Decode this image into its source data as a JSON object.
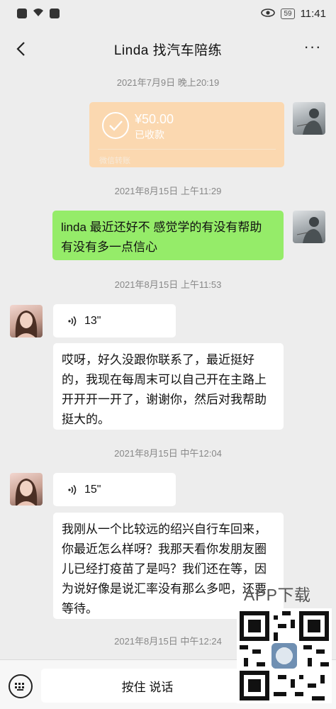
{
  "status_bar": {
    "time": "11:41",
    "battery": "59",
    "icons": [
      "alert-icon",
      "wifi-icon",
      "upload-icon",
      "eye-icon",
      "battery-icon"
    ]
  },
  "nav": {
    "title": "Linda 找汽车陪练",
    "back_icon": "chevron-left-icon",
    "more_icon": "more-dots-icon",
    "more_label": "···"
  },
  "messages": {
    "ts1": "2021年7月9日 晚上20:19",
    "transfer": {
      "amount": "¥50.00",
      "status": "已收款",
      "footer": "微信转账"
    },
    "ts2": "2021年8月15日 上午11:29",
    "msg1": "linda 最近还好不 感觉学的有没有帮助 有没有多一点信心",
    "ts3": "2021年8月15日 上午11:53",
    "voice1": "13\"",
    "msg2": "哎呀，好久没跟你联系了，最近挺好的，我现在每周末可以自己开在主路上开开开一开了，谢谢你，然后对我帮助挺大的。",
    "ts4": "2021年8月15日 中午12:04",
    "voice2": "15\"",
    "msg3": "我刚从一个比较远的绍兴自行车回来，你最近怎么样呀？我那天看你发朋友圈儿已经打疫苗了是吗？我们还在等，因为说好像是说汇率没有那么多吧，还要等待。",
    "ts5": "2021年8月15日 中午12:24"
  },
  "input_bar": {
    "keyboard_icon": "keyboard-icon",
    "talk_label": "按住 说话"
  },
  "watermark": {
    "text": "APP下载",
    "qr_icon": "qr-code-icon"
  },
  "colors": {
    "background": "#ededed",
    "my_bubble": "#95ec69",
    "their_bubble": "#ffffff",
    "transfer": "#fbd8b0"
  }
}
